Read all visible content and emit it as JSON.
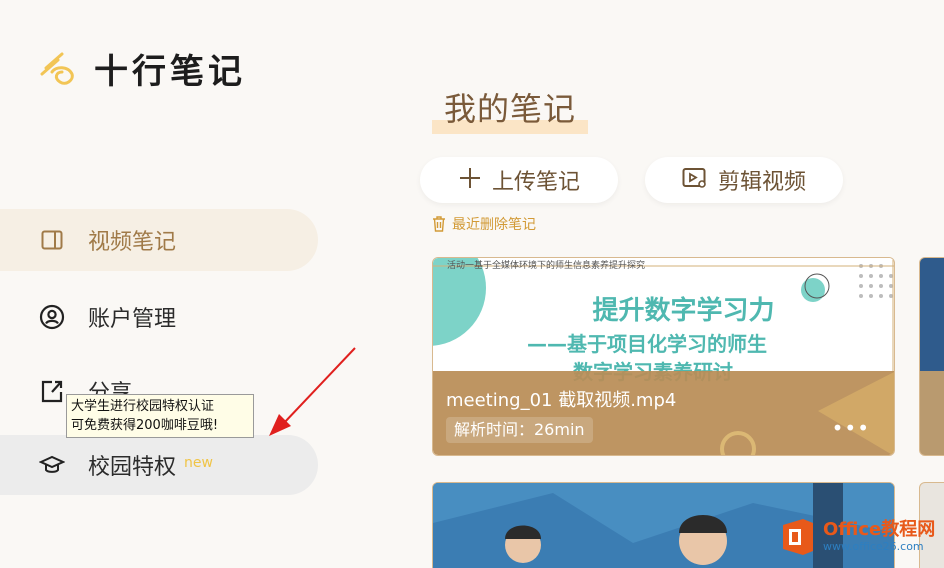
{
  "app": {
    "name": "十行笔记"
  },
  "sidebar": {
    "items": [
      {
        "label": "视频笔记",
        "icon": "sidebar-panel-icon",
        "active": true
      },
      {
        "label": "账户管理",
        "icon": "user-circle-icon"
      },
      {
        "label": "分享",
        "icon": "share-icon"
      },
      {
        "label": "校园特权",
        "icon": "graduation-cap-icon",
        "badge": "new"
      }
    ]
  },
  "tooltip": {
    "line1": "大学生进行校园特权认证",
    "line2": "可免费获得200咖啡豆哦!"
  },
  "main": {
    "title": "我的笔记",
    "upload_label": "上传笔记",
    "edit_label": "剪辑视频",
    "recent_deleted": "最近删除笔记"
  },
  "cards": [
    {
      "thumb_topline": "活动一基于全媒体环境下的师生信息素养提升探究",
      "thumb_title": "提升数字学习力",
      "thumb_subtitle": "——基于项目化学习的师生",
      "thumb_subtitle2": "数字学习素养研讨",
      "title": "meeting_01 截取视频.mp4",
      "meta": "解析时间：26min",
      "more": "•••"
    }
  ],
  "watermark": {
    "line1": "Office教程网",
    "line2": "www.office26.com"
  },
  "colors": {
    "accent": "#a07a48",
    "active_bg": "#f6efe4",
    "card_overlay": "#b98d56",
    "thumb_teal": "#4fb8b0",
    "badge": "#f0c446",
    "arrow": "#e0201e"
  }
}
